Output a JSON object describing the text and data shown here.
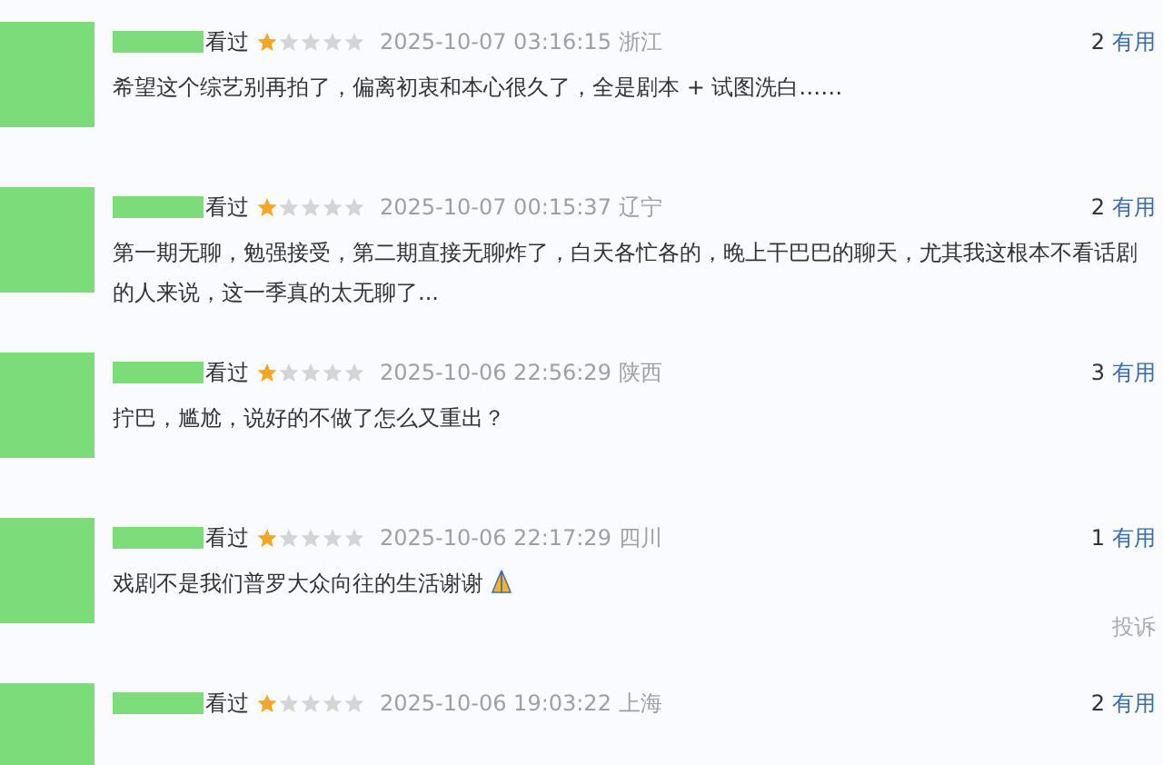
{
  "reviews": [
    {
      "status": "看过",
      "stars": 1,
      "time": "2025-10-07 03:16:15",
      "region": "浙江",
      "votes": "2",
      "vote_label": "有用",
      "text": "希望这个综艺别再拍了，偏离初衷和本心很久了，全是剧本 + 试图洗白……"
    },
    {
      "status": "看过",
      "stars": 1,
      "time": "2025-10-07 00:15:37",
      "region": "辽宁",
      "votes": "2",
      "vote_label": "有用",
      "text": "第一期无聊，勉强接受，第二期直接无聊炸了，白天各忙各的，晚上干巴巴的聊天，尤其我这根本不看话剧的人来说，这一季真的太无聊了..."
    },
    {
      "status": "看过",
      "stars": 1,
      "time": "2025-10-06 22:56:29",
      "region": "陕西",
      "votes": "3",
      "vote_label": "有用",
      "text": "拧巴，尴尬，说好的不做了怎么又重出？"
    },
    {
      "status": "看过",
      "stars": 1,
      "time": "2025-10-06 22:17:29",
      "region": "四川",
      "votes": "1",
      "vote_label": "有用",
      "text": "戏剧不是我们普罗大众向往的生活谢谢",
      "praying_hands": true,
      "report": "投诉"
    },
    {
      "status": "看过",
      "stars": 1,
      "time": "2025-10-06 19:03:22",
      "region": "上海",
      "votes": "2",
      "vote_label": "有用"
    }
  ]
}
